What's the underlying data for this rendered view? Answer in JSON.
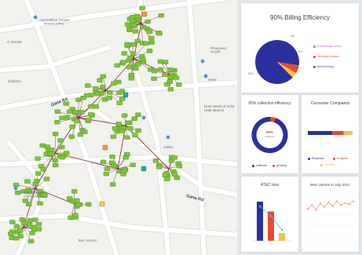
{
  "map": {
    "labels": [
      {
        "id": "kamakhya",
        "text": "Kamakhya Temple",
        "sub": "কামাখ্যা মন্দির"
      },
      {
        "id": "g_sonate",
        "text": "G Sonate"
      },
      {
        "id": "pharmacy",
        "text": "Pharmacy",
        "sub": "ফাৰ্মেচী"
      },
      {
        "id": "hotel",
        "text": "Hotel"
      },
      {
        "id": "ghat_no",
        "text": "Ghat No."
      },
      {
        "id": "dunn_bank",
        "text": "Dunn Bank of India",
        "sub": "Uttar Branch"
      },
      {
        "id": "cbbs",
        "text": "CBBS"
      },
      {
        "id": "gati_market",
        "text": "Gati Market",
        "sub": "গতি মার্কেট"
      },
      {
        "id": "buc_school",
        "text": "Buc School"
      }
    ],
    "roads": [
      {
        "id": "gana_rd",
        "text": "Gana Rd"
      },
      {
        "id": "ganesh_rd",
        "text": "Gana Rd"
      }
    ],
    "colors": {
      "node": "#7ec23a",
      "link": "#7a1a2e",
      "road": "#ffffff",
      "land": "#f1f2ee"
    }
  },
  "billing": {
    "title": "90% Billing Efficiency",
    "legend": [
      {
        "label": "Commercial Losses",
        "color": "#c764c9"
      },
      {
        "label": "Technical Losses",
        "color": "#e84a2e"
      },
      {
        "label": "Billed Energy",
        "color": "#3c5bbd"
      }
    ],
    "slices": [
      {
        "label": "Billed Energy",
        "value": 90,
        "color": "#2b2f9e"
      },
      {
        "label": "Technical Losses",
        "value": 6,
        "color": "#e84a2e"
      },
      {
        "label": "Commercial Losses",
        "value": 4,
        "color": "#f6bf4b"
      }
    ],
    "pct_labels": {
      "big": "90%",
      "top": "4%",
      "mid": "6%"
    }
  },
  "collection": {
    "title": "95% collection efficiency",
    "center": "95%",
    "center_sub": "collection",
    "legend": [
      {
        "label": "collected",
        "color": "#2b2f9e"
      },
      {
        "label": "pending",
        "color": "#e84a2e"
      }
    ],
    "value": 95
  },
  "complaints": {
    "title": "Consumer Complaints",
    "bar": [
      {
        "label": "Resolved",
        "value": 55,
        "color": "#2b2f9e"
      },
      {
        "label": "Progress",
        "value": 25,
        "color": "#e84a2e"
      },
      {
        "label": "Pending",
        "value": 20,
        "color": "#f6bf4b"
      }
    ]
  },
  "atc": {
    "title": "AT&C loss",
    "bars": [
      {
        "value": 100,
        "color": "#2b2f9e"
      },
      {
        "value": 75,
        "color": "#e84a2e"
      },
      {
        "value": 20,
        "color": "#f6bf4b"
      }
    ]
  },
  "uptime": {
    "title": "94% Uptime in July 2017",
    "values": [
      86,
      90,
      85,
      92,
      88,
      93,
      89,
      94,
      90,
      92,
      91,
      94
    ],
    "color": "#f2a78e"
  }
}
